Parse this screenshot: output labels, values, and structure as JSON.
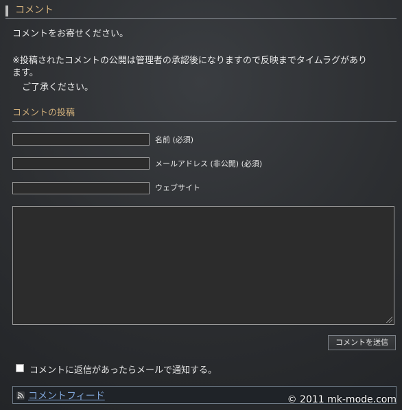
{
  "section": {
    "title": "コメント"
  },
  "intro": {
    "line1": "コメントをお寄せください。",
    "line2": "※投稿されたコメントの公開は管理者の承認後になりますので反映までタイムラグがあり",
    "line3": "ます。",
    "line4": "ご了承ください。"
  },
  "form": {
    "heading": "コメントの投稿",
    "name_label": "名前 (必須)",
    "email_label": "メールアドレス (非公開) (必須)",
    "website_label": "ウェブサイト",
    "name_value": "",
    "email_value": "",
    "website_value": "",
    "comment_value": "",
    "submit_label": "コメントを送信",
    "notify_label": "コメントに返信があったらメールで通知する。"
  },
  "footer": {
    "feed_link": "コメントフィード",
    "copyright": "© 2011 mk-mode.com"
  },
  "icons": {
    "rss": "rss-icon",
    "resize": "resize-grip-icon"
  },
  "colors": {
    "heading": "#cfae7a",
    "link": "#7fa5d8",
    "background": "#2b2d2f"
  }
}
